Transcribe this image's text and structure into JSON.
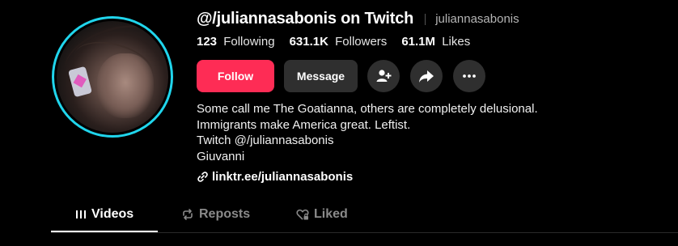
{
  "profile": {
    "display_name": "@/juliannasabonis on Twitch",
    "username": "juliannasabonis",
    "stats": [
      {
        "value": "123",
        "label": "Following"
      },
      {
        "value": "631.1K",
        "label": "Followers"
      },
      {
        "value": "61.1M",
        "label": "Likes"
      }
    ],
    "bio_lines": [
      "Some call me The Goatianna, others are completely delusional.",
      "Immigrants make America great. Leftist.",
      "Twitch @/juliannasabonis",
      "Giuvanni"
    ],
    "link": "linktr.ee/juliannasabonis"
  },
  "actions": {
    "follow_label": "Follow",
    "message_label": "Message",
    "icons": [
      "add-friend-icon",
      "share-icon",
      "more-icon"
    ]
  },
  "tabs": [
    {
      "label": "Videos",
      "icon": "grid-icon",
      "active": true
    },
    {
      "label": "Reposts",
      "icon": "repost-icon",
      "active": false
    },
    {
      "label": "Liked",
      "icon": "heart-lock-icon",
      "active": false
    }
  ],
  "colors": {
    "follow": "#fe2c55",
    "avatar_ring": "#20d5ec",
    "button_bg": "#2f2f2f"
  }
}
